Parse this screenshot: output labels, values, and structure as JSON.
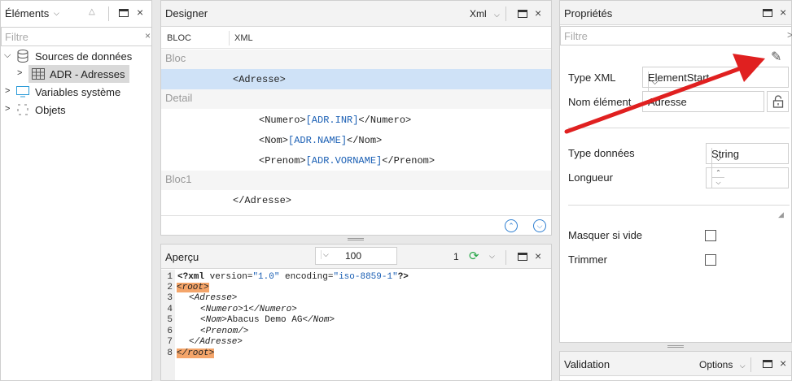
{
  "elements_panel": {
    "title": "Éléments",
    "filter_placeholder": "Filtre",
    "tree": [
      {
        "label": "Sources de données",
        "icon": "database-icon",
        "expanded": true
      },
      {
        "label": "ADR - Adresses",
        "icon": "table-grid-icon",
        "selected": true
      },
      {
        "label": "Variables système",
        "icon": "monitor-icon",
        "expanded": false
      },
      {
        "label": "Objets",
        "icon": "dashed-square-icon",
        "expanded": false
      }
    ]
  },
  "designer": {
    "title": "Designer",
    "format_label": "Xml",
    "col_bloc": "BLOC",
    "col_xml": "XML",
    "rows": {
      "bloc": "Bloc",
      "adresse_open": "<Adresse>",
      "detail": "Detail",
      "numero_open": "<Numero>",
      "numero_val": "[ADR.INR]",
      "numero_close": "</Numero>",
      "nom_open": "<Nom>",
      "nom_val": "[ADR.NAME]",
      "nom_close": "</Nom>",
      "prenom_open": "<Prenom>",
      "prenom_val": "[ADR.VORNAME]",
      "prenom_close": "</Prenom>",
      "bloc1": "Bloc1",
      "adresse_close": "</Adresse>"
    }
  },
  "apercu": {
    "title": "Aperçu",
    "zoom": "100",
    "page": "1",
    "lines": {
      "l1_a": "<?xml",
      "l1_b": " version=",
      "l1_c": "\"1.0\"",
      "l1_d": " encoding=",
      "l1_e": "\"iso-8859-1\"",
      "l1_f": "?>",
      "l2": "<root>",
      "l3": "<Adresse>",
      "l4_a": "<Numero>",
      "l4_b": "1",
      "l4_c": "</Numero>",
      "l5_a": "<Nom>",
      "l5_b": "Abacus Demo AG",
      "l5_c": "</Nom>",
      "l6": "<Prenom/>",
      "l7": "</Adresse>",
      "l8": "</root>"
    },
    "line_numbers": [
      "1",
      "2",
      "3",
      "4",
      "5",
      "6",
      "7",
      "8"
    ]
  },
  "properties": {
    "title": "Propriétés",
    "filter_placeholder": "Filtre",
    "type_xml_label": "Type XML",
    "type_xml_value": "ElementStart",
    "nom_element_label": "Nom élément",
    "nom_element_value": "Adresse",
    "type_donnees_label": "Type données",
    "type_donnees_value": "String",
    "longueur_label": "Longueur",
    "longueur_value": "",
    "masquer_label": "Masquer si vide",
    "trimmer_label": "Trimmer"
  },
  "validation": {
    "title": "Validation",
    "options_label": "Options"
  },
  "colors": {
    "selected_row": "#cfe2f7",
    "highlight_tag": "#f4a56a",
    "binding_blue": "#1a5fb4",
    "arrow_red": "#e02020",
    "refresh_green": "#2aa84a",
    "nav_blue": "#2f7fd1"
  }
}
